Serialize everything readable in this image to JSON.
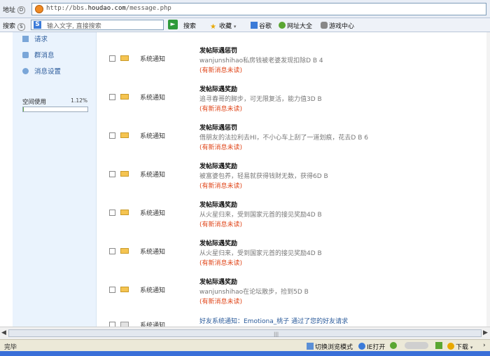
{
  "browser": {
    "address_label": "地址",
    "address_key": "D",
    "url_prefix": "http://bbs.",
    "url_domain": "houdao.com",
    "url_path": "/message.php"
  },
  "toolbar": {
    "search_label": "搜索",
    "search_key": "S",
    "search_placeholder": "输入文字, 直接搜索",
    "search_button": "搜索",
    "favorites": "收藏",
    "google": "谷歌",
    "sites": "网址大全",
    "games": "游戏中心"
  },
  "sidebar": {
    "items": [
      {
        "label": "请求"
      },
      {
        "label": "群消息"
      },
      {
        "label": "消息设置"
      }
    ],
    "usage_label": "空间使用",
    "usage_percent": "1.12%",
    "usage_fraction": 0.0112
  },
  "messages": [
    {
      "type": "系统通知",
      "title": "发帖际遇惩罚",
      "body": "wanjunshihao私房钱被老婆发现扣除D B 4",
      "status": "(有新消息未读)"
    },
    {
      "type": "系统通知",
      "title": "发帖际遇奖励",
      "body": "追寻春哥的脚步，可无限复活，能力值3D B",
      "status": "(有新消息未读)"
    },
    {
      "type": "系统通知",
      "title": "发帖际遇惩罚",
      "body": "借朋友的法拉利去HI，不小心车上刮了一道划痕，花去D B 6",
      "status": "(有新消息未读)"
    },
    {
      "type": "系统通知",
      "title": "发帖际遇奖励",
      "body": "被富婆包养，轻易就获得钱财无数，获得6D B",
      "status": "(有新消息未读)"
    },
    {
      "type": "系统通知",
      "title": "发帖际遇奖励",
      "body": "从火星归来，受到国家元首的接见奖励4D B",
      "status": "(有新消息未读)"
    },
    {
      "type": "系统通知",
      "title": "发帖际遇奖励",
      "body": "从火星归来，受到国家元首的接见奖励4D B",
      "status": "(有新消息未读)"
    },
    {
      "type": "系统通知",
      "title": "发帖际遇奖励",
      "body": "wanjunshihao在论坛散步，捡到5D B",
      "status": "(有新消息未读)"
    },
    {
      "type": "系统通知",
      "title": "好友系统通知：Emotiona_桃子 通过了您的好友请求",
      "body": "",
      "status": ""
    }
  ],
  "statusbar": {
    "done": "完毕",
    "switch_mode": "切换浏览模式",
    "ie_open": "IE打开",
    "download": "下载"
  }
}
